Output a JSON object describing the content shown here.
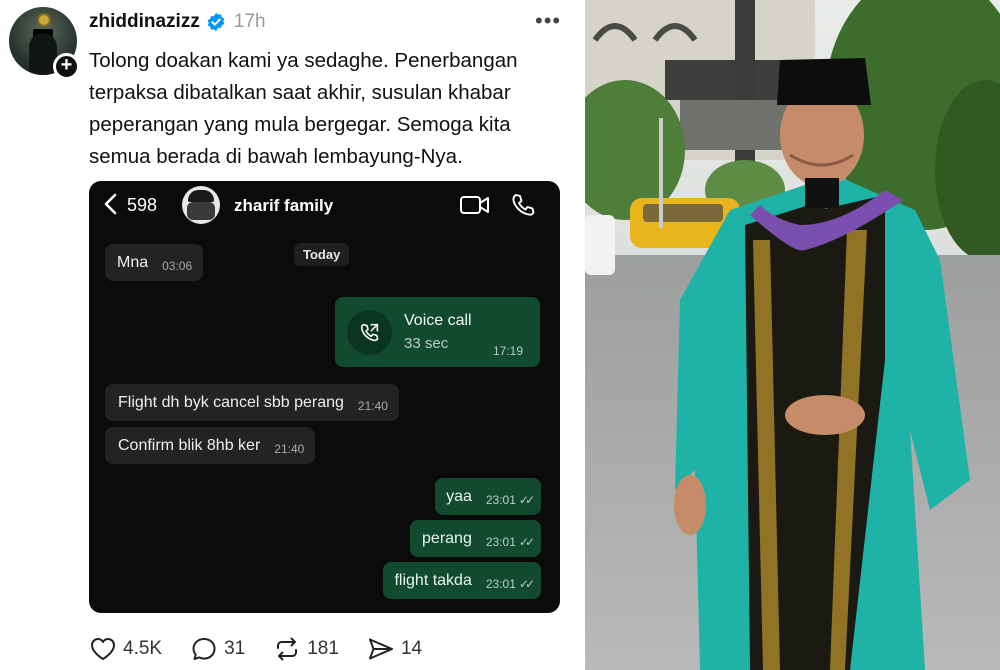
{
  "post": {
    "username": "zhiddinazizz",
    "time_ago": "17h",
    "caption": "Tolong doakan kami ya sedaghe. Penerbangan terpaksa dibatalkan saat akhir, susulan khabar peperangan yang mula bergegar. Semoga kita semua berada di bawah lembayung-Nya.",
    "more_icon": "ellipsis-icon",
    "verified_color": "#0095f6"
  },
  "chat": {
    "back_count": "598",
    "group_name": "zharif family",
    "date_label": "Today",
    "voice_call": {
      "title": "Voice call",
      "duration": "33 sec",
      "time": "17:19"
    },
    "messages": [
      {
        "dir": "in",
        "text": "Mna",
        "time": "03:06"
      },
      {
        "dir": "in",
        "text": "Flight dh byk cancel sbb perang",
        "time": "21:40"
      },
      {
        "dir": "in",
        "text": "Confirm blik 8hb ker",
        "time": "21:40"
      },
      {
        "dir": "out",
        "text": "yaa",
        "time": "23:01"
      },
      {
        "dir": "out",
        "text": "perang",
        "time": "23:01"
      },
      {
        "dir": "out",
        "text": "flight takda",
        "time": "23:01"
      }
    ],
    "read_ticks": "✓✓",
    "colors": {
      "background": "#0b0b0b",
      "incoming": "#222423",
      "outgoing": "#124a30"
    }
  },
  "actions": {
    "likes": "4.5K",
    "replies": "31",
    "reposts": "181",
    "shares": "14"
  }
}
